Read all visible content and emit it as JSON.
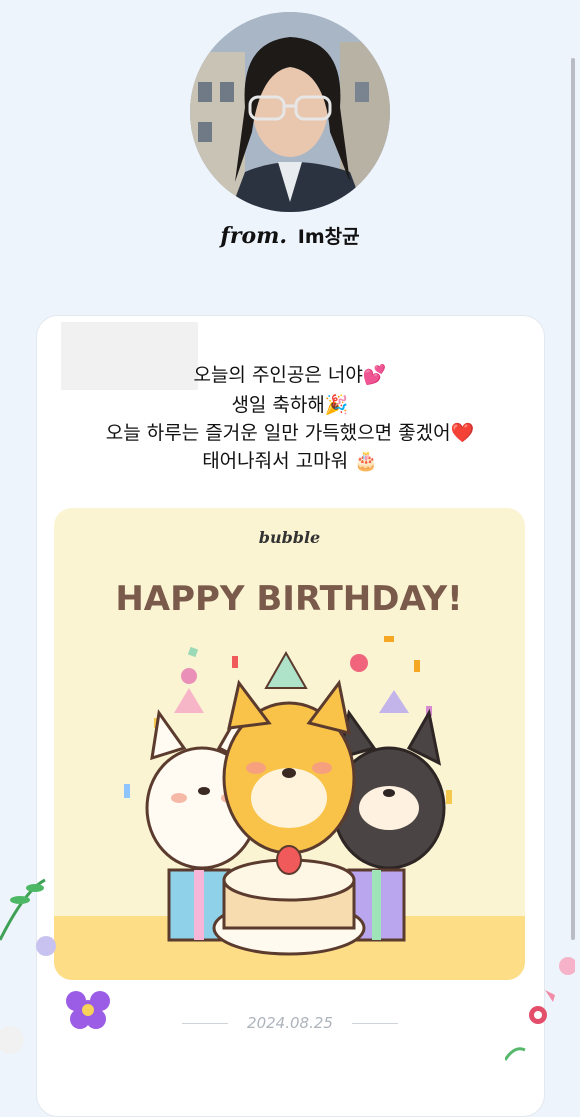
{
  "sender": {
    "from_label": "from.",
    "name": "Im창균"
  },
  "message": {
    "lines": [
      "오늘의 주인공은 너야💕",
      "생일 축하해🎉",
      "오늘 하루는 즐거운 일만 가득했으면 좋겠어❤️",
      "태어나줘서 고마워 🎂"
    ]
  },
  "birthday_card": {
    "brand": "bubble",
    "headline": "HAPPY BIRTHDAY!"
  },
  "date": "2024.08.25",
  "colors": {
    "background": "#eef4fb",
    "card_background": "#fbf4d3",
    "headline": "#7a5a4a"
  }
}
